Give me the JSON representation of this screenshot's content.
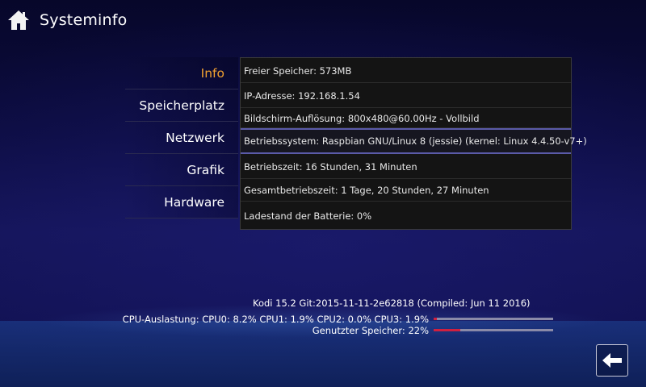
{
  "header": {
    "title": "Systeminfo",
    "icon": "home-icon"
  },
  "menu": {
    "items": [
      {
        "label": "Info",
        "active": true
      },
      {
        "label": "Speicherplatz",
        "active": false
      },
      {
        "label": "Netzwerk",
        "active": false
      },
      {
        "label": "Grafik",
        "active": false
      },
      {
        "label": "Hardware",
        "active": false
      }
    ]
  },
  "info": {
    "rows": [
      "Freier Speicher: 573MB",
      "IP-Adresse: 192.168.1.54",
      "Bildschirm-Auflösung: 800x480@60.00Hz - Vollbild",
      "Betriebssystem: Raspbian GNU/Linux 8 (jessie) (kernel: Linux 4.4.50-v7+)",
      "Betriebszeit: 16 Stunden, 31 Minuten",
      "Gesamtbetriebszeit: 1 Tage, 20 Stunden, 27 Minuten",
      "Ladestand der Batterie: 0%"
    ]
  },
  "footer": {
    "version": "Kodi 15.2 Git:2015-11-11-2e62818 (Compiled: Jun 11 2016)",
    "cpu_label": "CPU-Auslastung: CPU0: 8.2% CPU1: 1.9% CPU2: 0.0% CPU3: 1.9%",
    "cpu_usage_percent": 3,
    "mem_label": "Genutzter Speicher: 22%",
    "mem_usage_percent": 22
  },
  "controls": {
    "back_icon": "back-arrow-icon"
  },
  "colors": {
    "accent_active": "#f0a030",
    "bar_fill": "#d02040",
    "bar_track": "#8a8aa8",
    "row_highlight": "#5a5aa8"
  }
}
